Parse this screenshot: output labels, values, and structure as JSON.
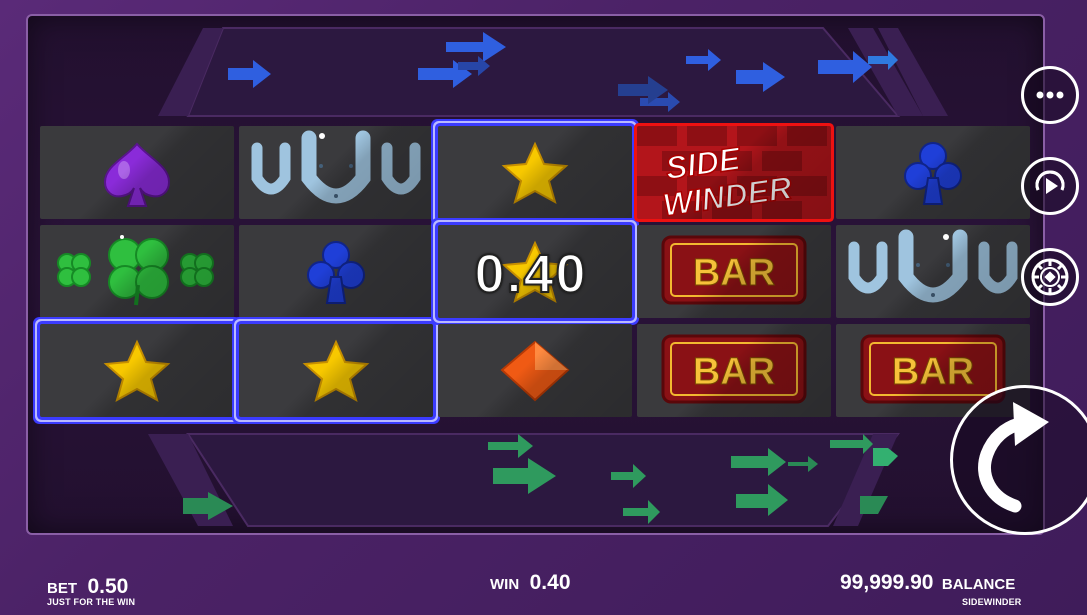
{
  "game": {
    "logo_text": [
      "SIDE",
      "WINDER"
    ]
  },
  "reels": [
    [
      "spade",
      "clover",
      "star"
    ],
    [
      "horseshoe",
      "club",
      "star"
    ],
    [
      "star",
      "star",
      "diamond"
    ],
    [
      "sidewinder",
      "bar",
      "bar"
    ],
    [
      "club",
      "horseshoe",
      "bar"
    ]
  ],
  "winning_cells": [
    [
      0,
      2
    ],
    [
      1,
      2
    ],
    [
      2,
      0
    ],
    [
      2,
      1
    ]
  ],
  "win_amount_overlay": "0.40",
  "symbol_text": {
    "bar": "BAR"
  },
  "side_buttons": {
    "menu_icon": "more-dots-icon",
    "autoplay_icon": "autoplay-icon",
    "bet_icon": "chip-icon",
    "spin_icon": "spin-arrow-icon"
  },
  "footer": {
    "bet_label": "BET",
    "bet_value": "0.50",
    "bet_subtitle": "JUST FOR THE WIN",
    "win_label": "WIN",
    "win_value": "0.40",
    "balance_value": "99,999.90",
    "balance_label": "BALANCE",
    "balance_subtitle": "SIDEWINDER"
  },
  "colors": {
    "win_frame": "#3b3bff",
    "top_arrows": "#2f5fe0",
    "bottom_arrows": "#2f9a5e",
    "background": "#4b2266"
  }
}
